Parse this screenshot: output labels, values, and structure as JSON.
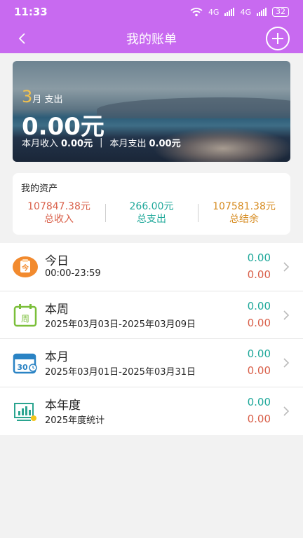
{
  "status_bar": {
    "time": "11:33",
    "net1": "4G",
    "net2": "4G",
    "battery": "32"
  },
  "header": {
    "title": "我的账单",
    "back_icon": "chevron-left-icon",
    "add_icon": "plus-circle-icon"
  },
  "banner": {
    "month_num": "3",
    "month_suffix": "月",
    "type_label": "支出",
    "amount": "0.00元",
    "income_label": "本月收入",
    "income_value": "0.00元",
    "separator": "|",
    "expense_label": "本月支出",
    "expense_value": "0.00元"
  },
  "assets": {
    "title": "我的资产",
    "items": [
      {
        "value": "107847.38元",
        "label": "总收入",
        "color": "#d9604a"
      },
      {
        "value": "266.00元",
        "label": "总支出",
        "color": "#1fa89a"
      },
      {
        "value": "107581.38元",
        "label": "总结余",
        "color": "#d68a1e"
      }
    ]
  },
  "periods": [
    {
      "name": "今日",
      "range": "00:00-23:59",
      "income": "0.00",
      "expense": "0.00",
      "icon": "today-clipboard-icon"
    },
    {
      "name": "本周",
      "range": "2025年03月03日-2025年03月09日",
      "income": "0.00",
      "expense": "0.00",
      "icon": "week-calendar-icon"
    },
    {
      "name": "本月",
      "range": "2025年03月01日-2025年03月31日",
      "income": "0.00",
      "expense": "0.00",
      "icon": "month-calendar-icon"
    },
    {
      "name": "本年度",
      "range": "2025年度统计",
      "income": "0.00",
      "expense": "0.00",
      "icon": "year-chart-icon"
    }
  ],
  "icon_text": {
    "today": "今",
    "week": "周",
    "month": "30"
  }
}
